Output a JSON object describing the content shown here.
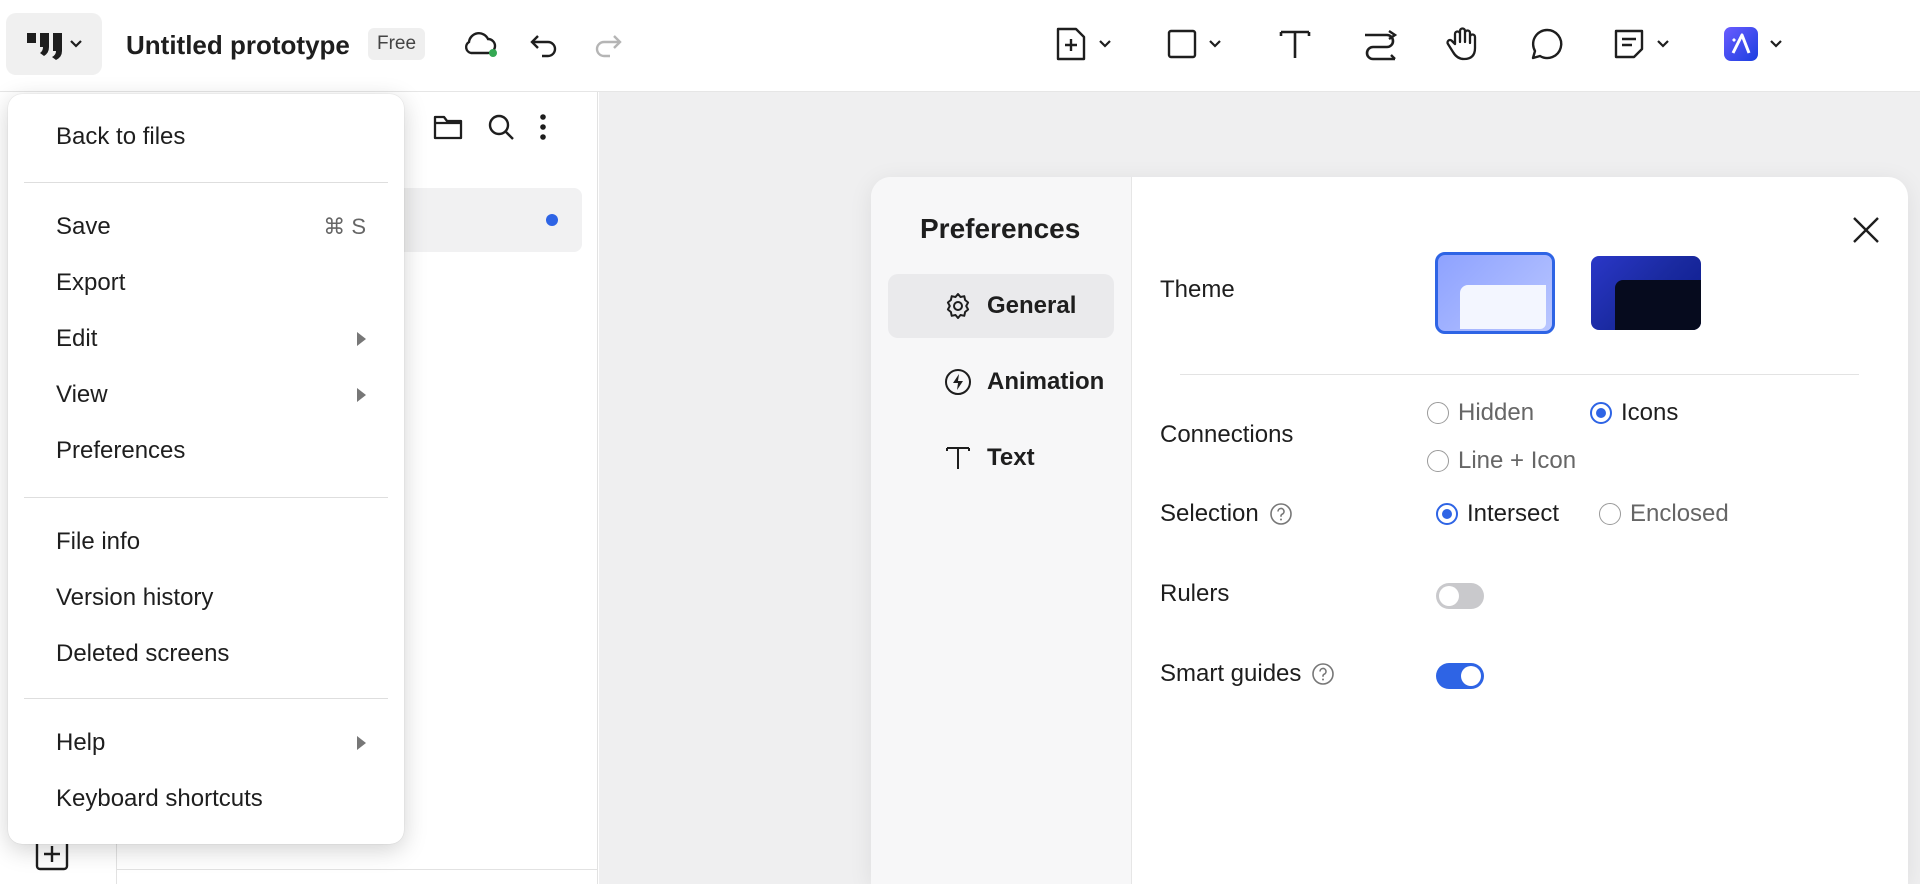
{
  "app": {
    "document_title": "Untitled prototype",
    "plan_badge": "Free"
  },
  "toolbar": {
    "tools": [
      "add-screen-icon",
      "rectangle-icon",
      "text-tool-icon",
      "connector-icon",
      "hand-icon",
      "comment-icon",
      "note-icon",
      "ai-icon"
    ]
  },
  "menu": {
    "items": [
      {
        "label": "Back to files"
      },
      {
        "label": "Save",
        "shortcut": "⌘ S"
      },
      {
        "label": "Export"
      },
      {
        "label": "Edit",
        "submenu": true
      },
      {
        "label": "View",
        "submenu": true
      },
      {
        "label": "Preferences"
      },
      {
        "label": "File info"
      },
      {
        "label": "Version history"
      },
      {
        "label": "Deleted screens"
      },
      {
        "label": "Help",
        "submenu": true
      },
      {
        "label": "Keyboard shortcuts"
      }
    ]
  },
  "preferences": {
    "title": "Preferences",
    "nav": [
      {
        "label": "General",
        "active": true
      },
      {
        "label": "Animation"
      },
      {
        "label": "Text"
      }
    ],
    "theme": {
      "label": "Theme",
      "selected": "light"
    },
    "connections": {
      "label": "Connections",
      "options": [
        "Hidden",
        "Icons",
        "Line + Icon"
      ],
      "selected": "Icons"
    },
    "selection": {
      "label": "Selection",
      "options": [
        "Intersect",
        "Enclosed"
      ],
      "selected": "Intersect"
    },
    "rulers": {
      "label": "Rulers",
      "enabled": false
    },
    "smart_guides": {
      "label": "Smart guides",
      "enabled": true
    }
  },
  "colors": {
    "accent": "#2e64e5",
    "canvas": "#efeff0"
  }
}
